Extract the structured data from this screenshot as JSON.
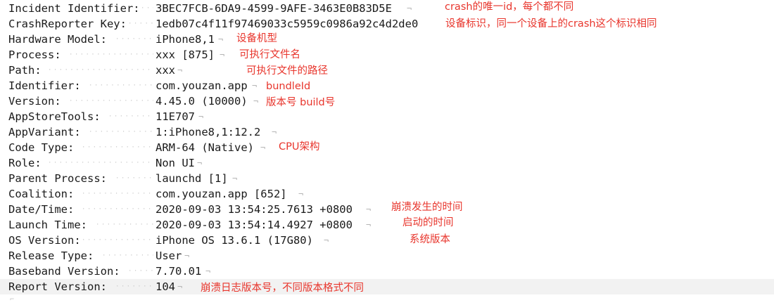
{
  "fields": [
    {
      "key": "Incident Identifier:",
      "value": "3BEC7FCB-6DA9-4599-9AFE-3463E0B83D5E"
    },
    {
      "key": "CrashReporter Key:",
      "value": "1edb07c4f11f97469033c5959c0986a92c4d2de0"
    },
    {
      "key": "Hardware Model:",
      "value": "iPhone8,1"
    },
    {
      "key": "Process:",
      "value": "xxx [875]"
    },
    {
      "key": "Path:",
      "value": "xxx"
    },
    {
      "key": "Identifier:",
      "value": "com.youzan.app"
    },
    {
      "key": "Version:",
      "value": "4.45.0 (10000)"
    },
    {
      "key": "AppStoreTools:",
      "value": "11E707"
    },
    {
      "key": "AppVariant:",
      "value": "1:iPhone8,1:12.2"
    },
    {
      "key": "Code Type:",
      "value": "ARM-64 (Native)"
    },
    {
      "key": "Role:",
      "value": "Non UI"
    },
    {
      "key": "Parent Process:",
      "value": "launchd [1]"
    },
    {
      "key": "Coalition:",
      "value": "com.youzan.app [652]"
    },
    {
      "key": "Date/Time:",
      "value": "2020-09-03 13:54:25.7613 +0800"
    },
    {
      "key": "Launch Time:",
      "value": "2020-09-03 13:54:14.4927 +0800"
    },
    {
      "key": "OS Version:",
      "value": "iPhone OS 13.6.1 (17G80)"
    },
    {
      "key": "Release Type:",
      "value": "User"
    },
    {
      "key": "Baseband Version:",
      "value": "7.70.01"
    },
    {
      "key": "Report Version:",
      "value": "104"
    }
  ],
  "annotations": {
    "incident_id": "crash的唯一id，每个都不同",
    "crash_reporter_key": "设备标识，同一个设备上的crash这个标识相同",
    "hardware_model": "设备机型",
    "process": "可执行文件名",
    "path": "可执行文件的路径",
    "identifier": "bundleId",
    "version": "版本号 build号",
    "code_type": "CPU架构",
    "date_time": "崩溃发生的时间",
    "launch_time": "启动的时间",
    "os_version": "系统版本",
    "report_version": "崩溃日志版本号，不同版本格式不同"
  },
  "colors": {
    "annotation": "#e8352c",
    "text": "#1a1a1a",
    "dots": "#c8c8c8",
    "highlight_row": "#f2f2f2"
  }
}
